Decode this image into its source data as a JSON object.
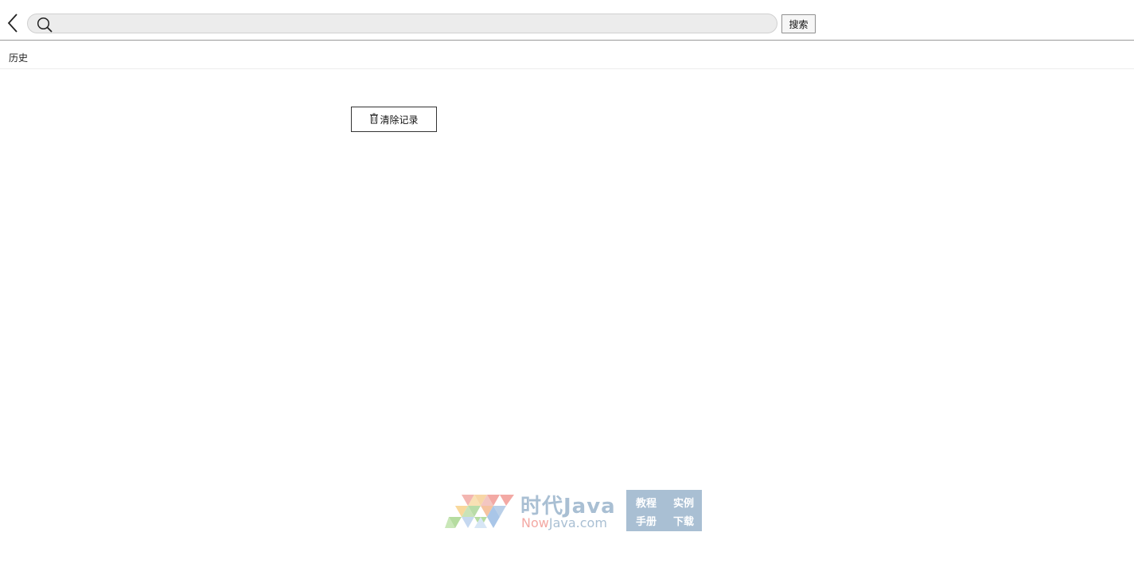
{
  "search": {
    "value": "",
    "placeholder": "",
    "button_label": "搜索"
  },
  "history": {
    "title": "历史",
    "clear_label": "清除记录"
  },
  "watermark": {
    "title": "时代Java",
    "sub_now": "Now",
    "sub_java": "Java.com",
    "tags": [
      "教程",
      "实例",
      "手册",
      "下载"
    ]
  },
  "icons": {
    "back": "chevron-left-icon",
    "search": "search-icon",
    "trash": "trash-icon"
  },
  "colors": {
    "search_bg": "#ececec",
    "divider": "#9a9a9a",
    "watermark_blue": "#a9bfd3",
    "watermark_pink": "#f3a9a4"
  }
}
